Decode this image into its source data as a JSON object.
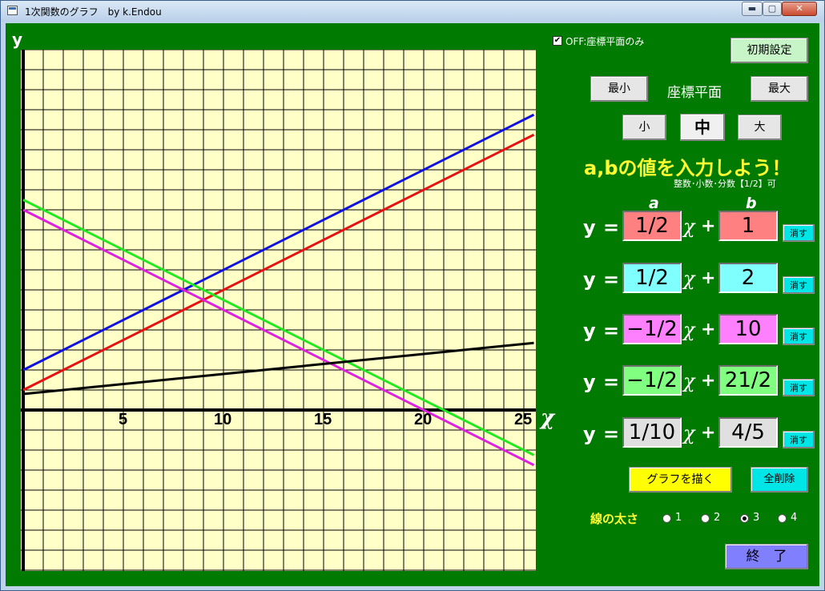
{
  "window": {
    "title": "1次関数のグラフ　by k.Endou",
    "min_glyph": "▬",
    "max_glyph": "▢",
    "close_glyph": "✕"
  },
  "graph": {
    "y_label": "y",
    "x_label": "χ",
    "x_ticks": [
      "5",
      "10",
      "15",
      "20",
      "25"
    ],
    "grid_on": true,
    "x_range": [
      0,
      25.5
    ],
    "y_range": [
      -8,
      18
    ],
    "colors": {
      "background": "#ffffc8",
      "grid": "#000000"
    }
  },
  "chart_data": {
    "type": "line",
    "x": [
      0,
      25.5
    ],
    "series": [
      {
        "color": "#e81010",
        "values": [
          1,
          13.75
        ]
      },
      {
        "color": "#1010e0",
        "values": [
          2,
          14.75
        ]
      },
      {
        "color": "#e020e0",
        "values": [
          10,
          -2.75
        ]
      },
      {
        "color": "#22e822",
        "values": [
          10.5,
          -2.25
        ]
      },
      {
        "color": "#000000",
        "values": [
          0.8,
          3.35
        ]
      }
    ]
  },
  "controls": {
    "checkbox_label": "OFF:座標平面のみ",
    "checkbox_checked": true,
    "reset_label": "初期設定",
    "min_label": "最小",
    "plane_label": "座標平面",
    "max_label": "最大",
    "size_small": "小",
    "size_medium": "中",
    "size_large": "大",
    "heading": "a,bの値を入力しよう！",
    "subheading": "整数･小数･分数【1/2】可",
    "col_a": "a",
    "col_b": "b"
  },
  "equations": [
    {
      "y": "y",
      "eq": "=",
      "a": "1/2",
      "x": "χ",
      "plus": "+",
      "b": "1",
      "clear": "消す",
      "color": "#ff8080"
    },
    {
      "y": "y",
      "eq": "=",
      "a": "1/2",
      "x": "χ",
      "plus": "+",
      "b": "2",
      "clear": "消す",
      "color": "#80ffff"
    },
    {
      "y": "y",
      "eq": "=",
      "a": "−1/2",
      "x": "χ",
      "plus": "+",
      "b": "10",
      "clear": "消す",
      "color": "#ff80ff"
    },
    {
      "y": "y",
      "eq": "=",
      "a": "−1/2",
      "x": "χ",
      "plus": "+",
      "b": "21/2",
      "clear": "消す",
      "color": "#80ff80"
    },
    {
      "y": "y",
      "eq": "=",
      "a": "1/10",
      "x": "χ",
      "plus": "+",
      "b": "4/5",
      "clear": "消す",
      "color": "#e0e0e0"
    }
  ],
  "actions": {
    "draw_label": "グラフを描く",
    "clear_all_label": "全削除",
    "exit_label": "終　了"
  },
  "thickness": {
    "label": "線の太さ",
    "options": [
      "1",
      "2",
      "3",
      "4"
    ],
    "selected": "3"
  }
}
